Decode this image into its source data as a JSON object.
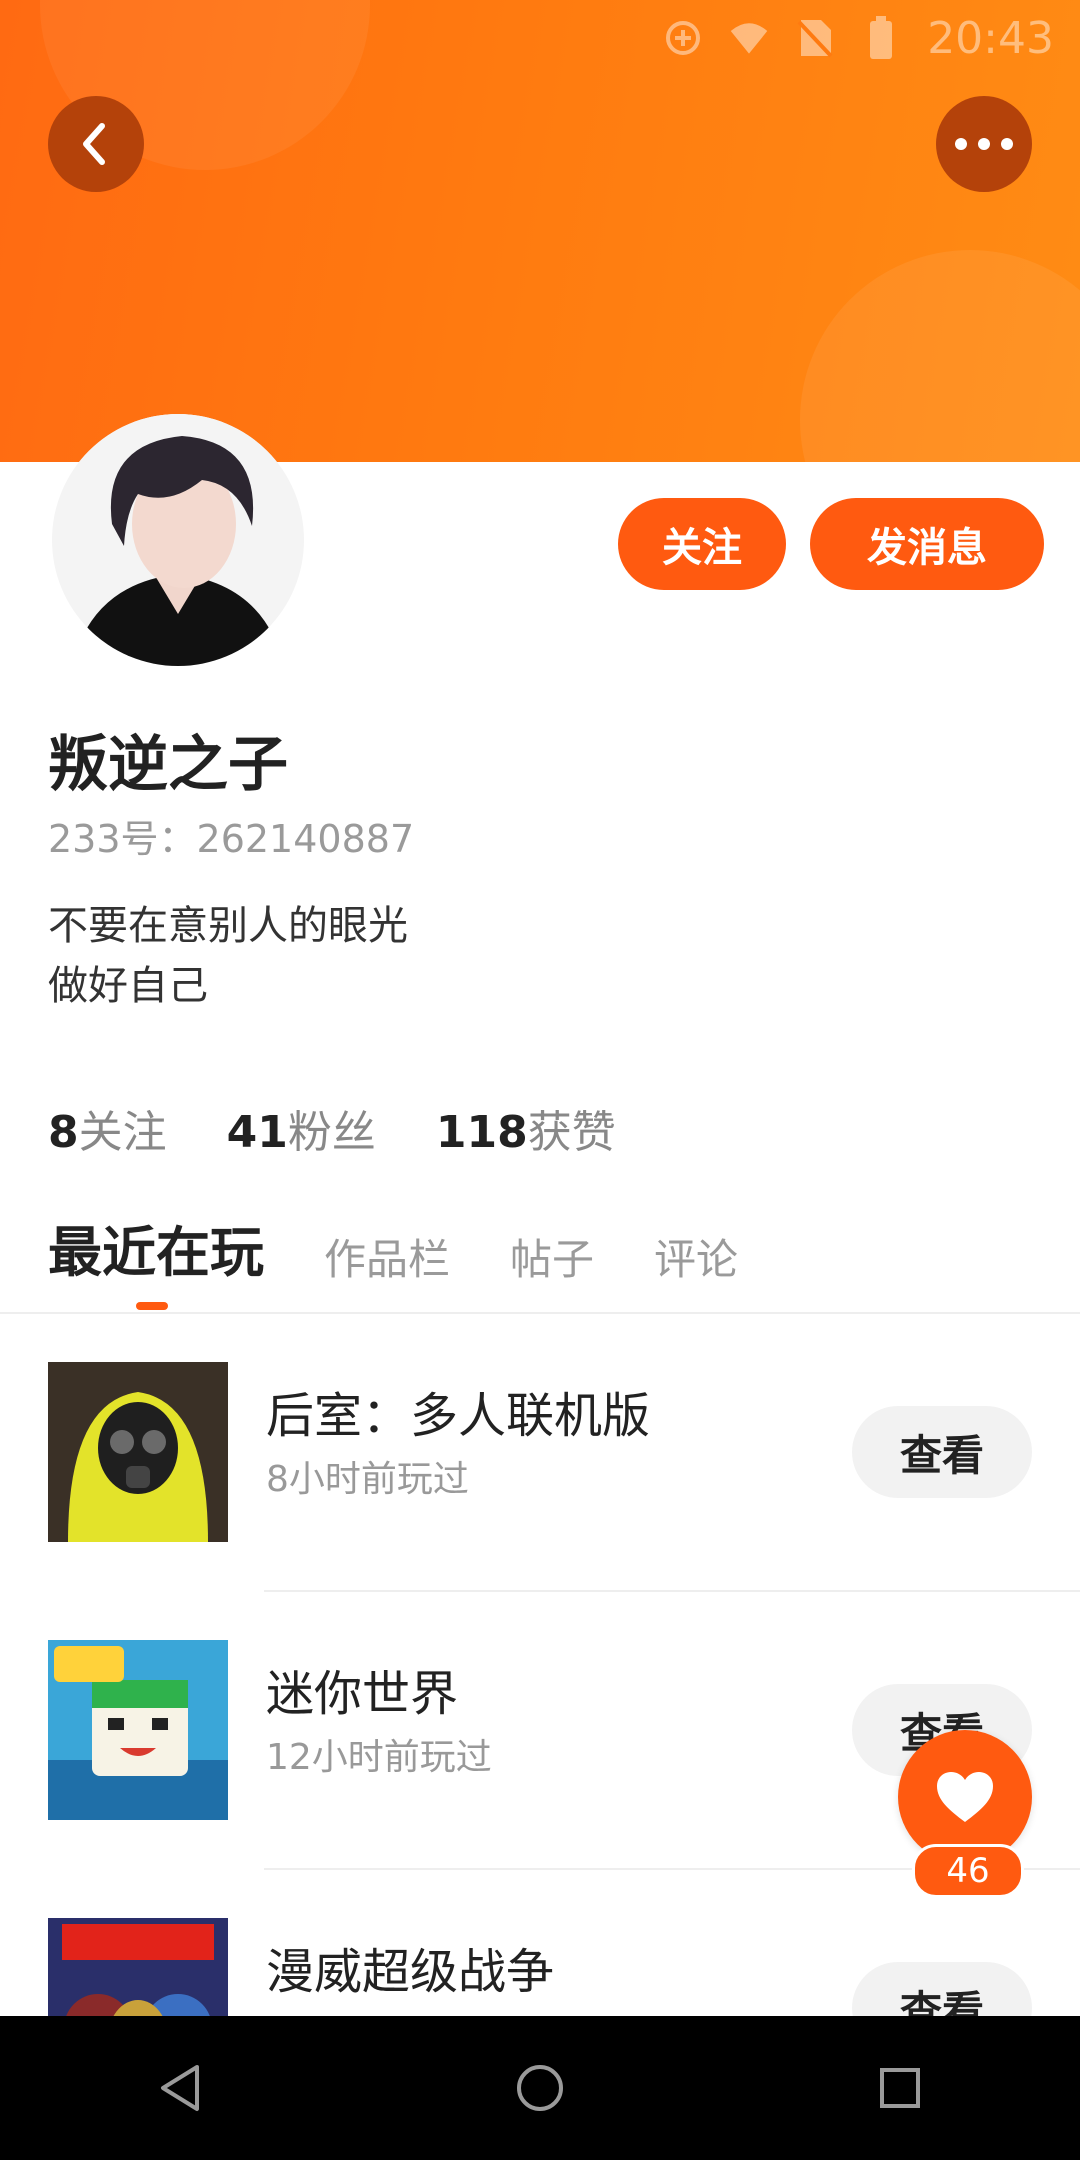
{
  "status_bar": {
    "time": "20:43"
  },
  "profile": {
    "name": "叛逆之子",
    "id_label": "233号：262140887",
    "bio": [
      "不要在意别人的眼光",
      "做好自己"
    ],
    "follow_label": "关注",
    "message_label": "发消息"
  },
  "stats": [
    {
      "num": "8",
      "label": "关注"
    },
    {
      "num": "41",
      "label": "粉丝"
    },
    {
      "num": "118",
      "label": "获赞"
    }
  ],
  "tabs": [
    {
      "label": "最近在玩",
      "active": true
    },
    {
      "label": "作品栏",
      "active": false
    },
    {
      "label": "帖子",
      "active": false
    },
    {
      "label": "评论",
      "active": false
    }
  ],
  "games": [
    {
      "title": "后室：多人联机版",
      "played": "8小时前玩过",
      "button": "查看"
    },
    {
      "title": "迷你世界",
      "played": "12小时前玩过",
      "button": "查看"
    },
    {
      "title": "漫威超级战争",
      "played": "",
      "button": "查看"
    }
  ],
  "like": {
    "count": "46"
  },
  "icons": {
    "back": "chevron-left-icon",
    "more": "more-dots-icon",
    "like": "heart-icon",
    "nav_back": "triangle-back-icon",
    "nav_home": "circle-home-icon",
    "nav_recent": "square-recent-icon"
  },
  "colors": {
    "accent": "#ff5a10",
    "banner": "#ff7a10"
  }
}
